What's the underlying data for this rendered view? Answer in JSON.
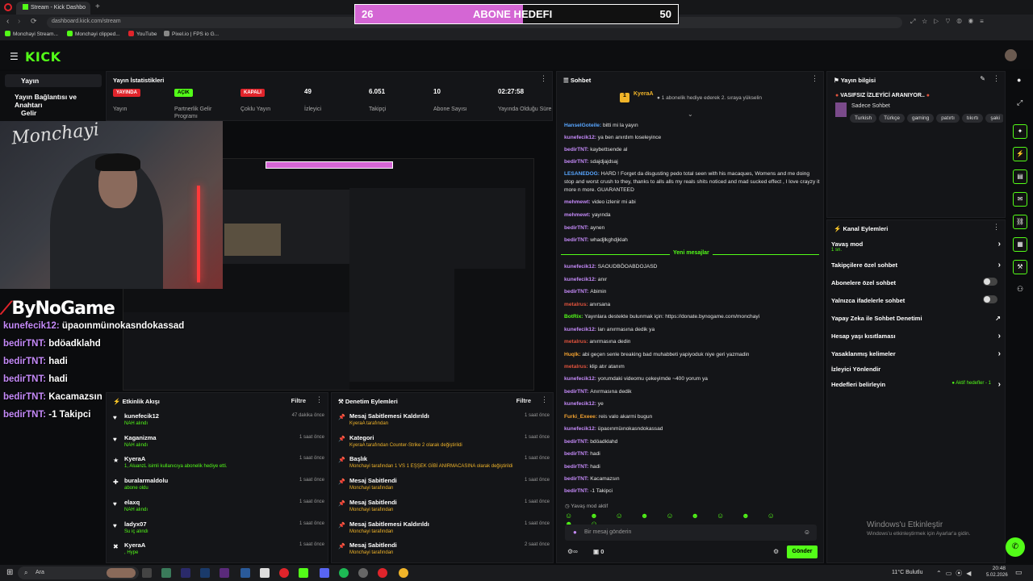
{
  "browser": {
    "tab_title": "Stream - Kick Dashbo",
    "url": "dashboard.kick.com/stream",
    "bookmarks": [
      "Monchayi Stream...",
      "Monchayi clipped...",
      "YouTube",
      "Pixel.io | FPS io G..."
    ]
  },
  "goal": {
    "left": "26",
    "label": "ABONE HEDEFI",
    "right": "50",
    "progress": 0.52
  },
  "kick": {
    "logo": "KICK"
  },
  "leftnav": {
    "items": [
      "Yayın",
      "Yayın Bağlantısı ve Anahtarı",
      "Gelir"
    ]
  },
  "stats": {
    "title": "Yayın İstatistikleri",
    "items": [
      {
        "value": "YAYINDA",
        "label": "Yayın",
        "kind": "badge-red"
      },
      {
        "value": "AÇIK",
        "label": "Partnerlik Gelir Programı",
        "kind": "badge-green"
      },
      {
        "value": "KAPALI",
        "label": "Çoklu Yayın",
        "kind": "badge-red"
      },
      {
        "value": "49",
        "label": "İzleyici"
      },
      {
        "value": "6.051",
        "label": "Takipçi"
      },
      {
        "value": "10",
        "label": "Abone Sayısı"
      },
      {
        "value": "02:27:58",
        "label": "Yayında Olduğu Süre"
      }
    ]
  },
  "cam": {
    "overlay_name": "Monchayi"
  },
  "sponsor": "ByNoGame",
  "overlay_chat": [
    {
      "user": "kunefecik12",
      "msg": "üpaoınmüınokasndokassad"
    },
    {
      "user": "bedirTNT",
      "msg": "bdöadklahd"
    },
    {
      "user": "bedirTNT",
      "msg": "hadi"
    },
    {
      "user": "bedirTNT",
      "msg": "hadi"
    },
    {
      "user": "bedirTNT",
      "msg": "Kacamazsın"
    },
    {
      "user": "bedirTNT",
      "msg": "-1 Takipci"
    }
  ],
  "activity": {
    "title": "Etkinlik Akışı",
    "filter": "Filtre",
    "rows": [
      {
        "name": "kunefecik12",
        "sub": "NAH alındı",
        "time": "47 dakika önce",
        "icon": "♥"
      },
      {
        "name": "Kaganizma",
        "sub": "NAH alındı",
        "time": "1 saat önce",
        "icon": "♥"
      },
      {
        "name": "KyeraA",
        "sub": "1, AluanzL isimli kullanıcıya abonelik hediye etti.",
        "time": "1 saat önce",
        "icon": "★"
      },
      {
        "name": "buralarmaldolu",
        "sub": "abone oldu",
        "time": "1 saat önce",
        "icon": "✚"
      },
      {
        "name": "elaxq",
        "sub": "NAH alındı",
        "time": "1 saat önce",
        "icon": "♥"
      },
      {
        "name": "ladyx07",
        "sub": "Su iç alındı",
        "time": "1 saat önce",
        "icon": "♥"
      },
      {
        "name": "KyeraA",
        "sub": ", Hype",
        "time": "1 saat önce",
        "icon": "✖"
      }
    ]
  },
  "moderation": {
    "title": "Denetim Eylemleri",
    "filter": "Filtre",
    "rows": [
      {
        "name": "Mesaj Sabitlemesi Kaldırıldı",
        "sub": "KyeraA tarafından",
        "time": "1 saat önce"
      },
      {
        "name": "Kategori",
        "sub": "KyeraA tarafından Counter-Strike 2 olarak değiştirildi",
        "time": "1 saat önce"
      },
      {
        "name": "Başlık",
        "sub": "Monchayi tarafından 1 VS 1 EŞŞEK GİBİ ANIRMACASINA olarak değiştirildi",
        "time": "1 saat önce"
      },
      {
        "name": "Mesaj Sabitlendi",
        "sub": "Monchayi tarafından",
        "time": "1 saat önce"
      },
      {
        "name": "Mesaj Sabitlendi",
        "sub": "Monchayi tarafından",
        "time": "1 saat önce"
      },
      {
        "name": "Mesaj Sabitlemesi Kaldırıldı",
        "sub": "Monchayi tarafından",
        "time": "1 saat önce"
      },
      {
        "name": "Mesaj Sabitlendi",
        "sub": "Monchayi tarafından",
        "time": "2 saat önce"
      }
    ]
  },
  "chat": {
    "title": "Sohbet",
    "pinned_user": "KyeraA",
    "pinned_text": "1 abonelik hediye ederek 2. sıraya yükselin",
    "new_messages": "Yeni mesajlar",
    "messages": [
      {
        "user": "HanselGoteile",
        "color": "#58a6ff",
        "text": "bitti mi la yayın"
      },
      {
        "user": "kunefecik12",
        "color": "#c58af9",
        "text": "ya ben anırdım loseleyince"
      },
      {
        "user": "bedirTNT",
        "color": "#c58af9",
        "text": "kaybettsende al"
      },
      {
        "user": "bedirTNT",
        "color": "#c58af9",
        "text": "sdajdjajdsaj"
      },
      {
        "user": "LESANEDOG",
        "color": "#58a6ff",
        "text": "HARD ! Forget da disgusting pedo total seen with his macaques, Womens and me doing stop and worst crush to they, thanks to alls alls my reals shits noticed and mad sucked effect , I love crayzy it more n more. GUARANTEED"
      },
      {
        "user": "mehmewt",
        "color": "#c58af9",
        "text": "video izlenir mi abi"
      },
      {
        "user": "mehmewt",
        "color": "#c58af9",
        "text": "yayında"
      },
      {
        "user": "bedirTNT",
        "color": "#c58af9",
        "text": "aynen"
      },
      {
        "user": "bedirTNT",
        "color": "#c58af9",
        "text": "whadjlkghdjklah"
      },
      {
        "user": "kunefecik12",
        "color": "#c58af9",
        "text": "SAOUDBÖOABDOJASD"
      },
      {
        "user": "kunefecik12",
        "color": "#c58af9",
        "text": "anır"
      },
      {
        "user": "bedirTNT",
        "color": "#c58af9",
        "text": "Abimin"
      },
      {
        "user": "metalrus",
        "color": "#e0533d",
        "text": "anırsana"
      },
      {
        "user": "BotRix",
        "color": "#53fc18",
        "text": "Yayınlara destekte bulunmak için: https://donate.bynogame.com/monchayi"
      },
      {
        "user": "kunefecik12",
        "color": "#c58af9",
        "text": "ları anırmasına dedik ya"
      },
      {
        "user": "metalrus",
        "color": "#e0533d",
        "text": "anırmasına dedin"
      },
      {
        "user": "Huqlk",
        "color": "#f0a030",
        "text": "abi geçen senle breaking bad muhabbeti yapiyoduk niye geri yazmadin"
      },
      {
        "user": "metalrus",
        "color": "#e0533d",
        "text": "klip atır atanım"
      },
      {
        "user": "kunefecik12",
        "color": "#c58af9",
        "text": "yorumdaki videomu çekeyimde ~400 yorum ya"
      },
      {
        "user": "bedirTNT",
        "color": "#c58af9",
        "text": "Anırmasına dedik"
      },
      {
        "user": "kunefecik12",
        "color": "#c58af9",
        "text": "ye"
      },
      {
        "user": "Furki_Exeee",
        "color": "#f0a030",
        "text": "reis valo akarmi bugun"
      },
      {
        "user": "kunefecik12",
        "color": "#c58af9",
        "text": "üpaoınmüınokasndokassad"
      },
      {
        "user": "bedirTNT",
        "color": "#c58af9",
        "text": "bdöadklahd"
      },
      {
        "user": "bedirTNT",
        "color": "#c58af9",
        "text": "hadi"
      },
      {
        "user": "bedirTNT",
        "color": "#c58af9",
        "text": "hadi"
      },
      {
        "user": "bedirTNT",
        "color": "#c58af9",
        "text": "Kacamazsın"
      },
      {
        "user": "bedirTNT",
        "color": "#c58af9",
        "text": "-1 Takipci"
      }
    ],
    "slow_mode": "Yavaş mod aktif",
    "input_placeholder": "Bir mesaj gönderin",
    "count": "0",
    "send": "Gönder"
  },
  "stream_info": {
    "title": "Yayın bilgisi",
    "stream_title": "VASIFSIZ İZLEYİCİ ARANIYOR..",
    "category": "Sadece Sohbet",
    "tags": [
      "Turkish",
      "Türkçe",
      "gaming",
      "patırtı",
      "tıkırtı",
      "şaki"
    ]
  },
  "channel_actions": {
    "title": "Kanal Eylemleri",
    "items": [
      {
        "label": "Yavaş mod",
        "sub": "1 sn.",
        "ctrl": "chev"
      },
      {
        "label": "Takipçilere özel sohbet",
        "ctrl": "chev"
      },
      {
        "label": "Abonelere özel sohbet",
        "ctrl": "toggle"
      },
      {
        "label": "Yalnızca ifadelerle sohbet",
        "ctrl": "toggle"
      },
      {
        "label": "Yapay Zeka ile Sohbet Denetimi",
        "ctrl": "ext"
      },
      {
        "label": "Hesap yaşı kısıtlaması",
        "ctrl": "chev"
      },
      {
        "label": "Yasaklanmış kelimeler",
        "ctrl": "chev"
      },
      {
        "label": "İzleyici Yönlendir",
        "ctrl": "none"
      },
      {
        "label": "Hedefleri belirleyin",
        "ctrl": "chev",
        "extra": "Aktif hedefler - 1"
      }
    ]
  },
  "windows": {
    "activate_title": "Windows'u Etkinleştir",
    "activate_sub": "Windows'u etkinleştirmek için Ayarlar'a gidin."
  },
  "taskbar": {
    "search": "Ara",
    "weather": "11°C  Bulutlu",
    "time": "20:48",
    "date": "5.02.2026"
  },
  "colors": {
    "accent": "#53fc18",
    "goal_fill": "#d466d4",
    "live_red": "#e0242b"
  }
}
